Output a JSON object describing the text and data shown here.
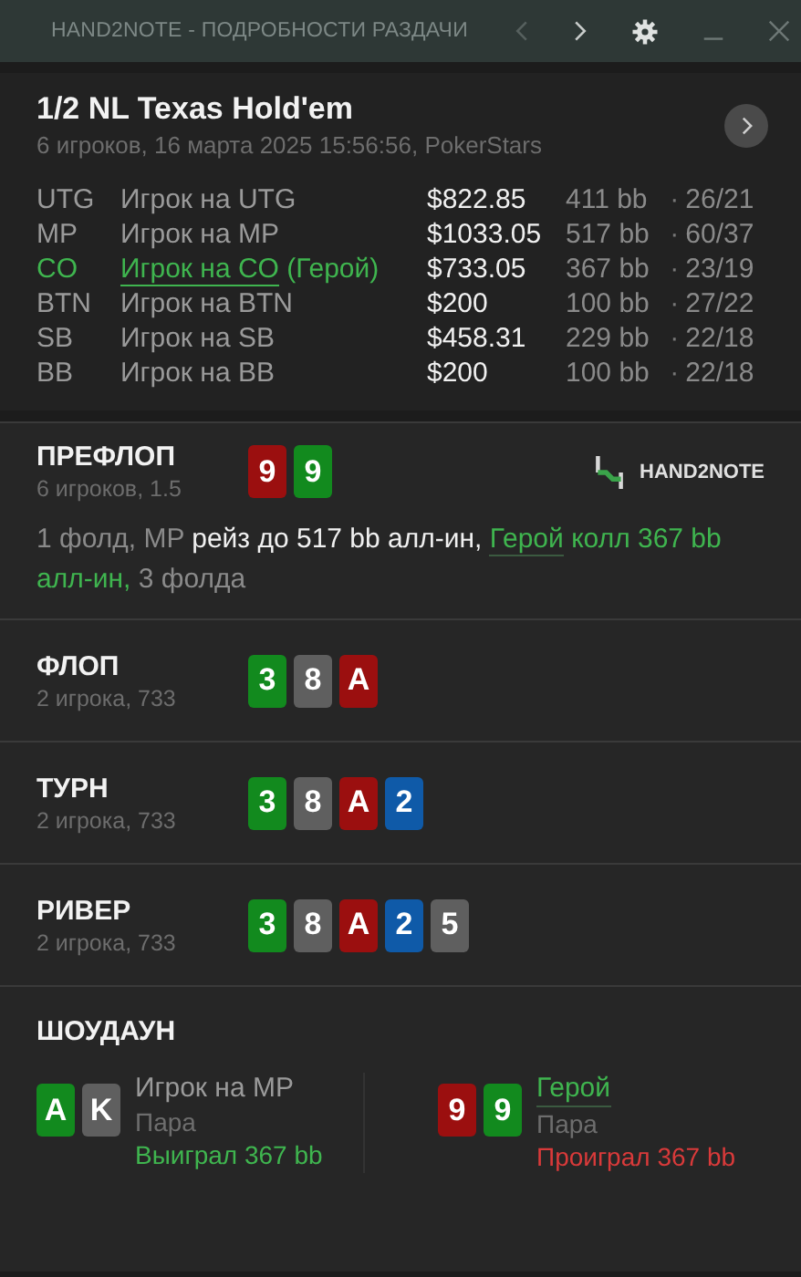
{
  "window": {
    "title": "HAND2NOTE - ПОДРОБНОСТИ РАЗДАЧИ"
  },
  "hand": {
    "title": "1/2 NL Texas Hold'em",
    "subtitle": "6 игроков, 16 марта 2025 15:56:56, PokerStars"
  },
  "players": [
    {
      "position": "UTG",
      "name": "Игрок на UTG",
      "stack": "$822.85",
      "bb": "411 bb",
      "separator": "·",
      "stats": "26/21",
      "hero": false
    },
    {
      "position": "MP",
      "name": "Игрок на MP",
      "stack": "$1033.05",
      "bb": "517 bb",
      "separator": "·",
      "stats": "60/37",
      "hero": false
    },
    {
      "position": "CO",
      "name": "Игрок на CO",
      "tag": "(Герой)",
      "stack": "$733.05",
      "bb": "367 bb",
      "separator": "·",
      "stats": "23/19",
      "hero": true
    },
    {
      "position": "BTN",
      "name": "Игрок на BTN",
      "stack": "$200",
      "bb": "100 bb",
      "separator": "·",
      "stats": "27/22",
      "hero": false
    },
    {
      "position": "SB",
      "name": "Игрок на SB",
      "stack": "$458.31",
      "bb": "229 bb",
      "separator": "·",
      "stats": "22/18",
      "hero": false
    },
    {
      "position": "BB",
      "name": "Игрок на BB",
      "stack": "$200",
      "bb": "100 bb",
      "separator": "·",
      "stats": "22/18",
      "hero": false
    }
  ],
  "preflop": {
    "title": "ПРЕФЛОП",
    "subtitle": "6 игроков, 1.5",
    "cards": [
      {
        "rank": "9",
        "color": "#9b0f0f"
      },
      {
        "rank": "9",
        "color": "#128a1e"
      }
    ],
    "logo": "HAND2NOTE",
    "action": [
      {
        "text": "1 фолд, MP ",
        "kind": "muted"
      },
      {
        "text": "рейз до 517 bb алл-ин, ",
        "kind": "bright"
      },
      {
        "text": "Герой",
        "kind": "link"
      },
      {
        "text": " колл 367 bb алл-ин,",
        "kind": "hero"
      },
      {
        "text": " 3 фолда",
        "kind": "muted"
      }
    ]
  },
  "streets": [
    {
      "title": "ФЛОП",
      "subtitle": "2 игрока, 733",
      "cards": [
        {
          "rank": "3",
          "color": "#128a1e"
        },
        {
          "rank": "8",
          "color": "#5f5f5f"
        },
        {
          "rank": "A",
          "color": "#9b0f0f"
        }
      ]
    },
    {
      "title": "ТУРН",
      "subtitle": "2 игрока, 733",
      "cards": [
        {
          "rank": "3",
          "color": "#128a1e"
        },
        {
          "rank": "8",
          "color": "#5f5f5f"
        },
        {
          "rank": "A",
          "color": "#9b0f0f"
        },
        {
          "rank": "2",
          "color": "#0f5aa8"
        }
      ]
    },
    {
      "title": "РИВЕР",
      "subtitle": "2 игрока, 733",
      "cards": [
        {
          "rank": "3",
          "color": "#128a1e"
        },
        {
          "rank": "8",
          "color": "#5f5f5f"
        },
        {
          "rank": "A",
          "color": "#9b0f0f"
        },
        {
          "rank": "2",
          "color": "#0f5aa8"
        },
        {
          "rank": "5",
          "color": "#5f5f5f"
        }
      ]
    }
  ],
  "showdown": {
    "title": "ШОУДАУН",
    "players": [
      {
        "name": "Игрок на MP",
        "hero": false,
        "hand": "Пара",
        "result": "Выиграл 367 bb",
        "won": true,
        "cards": [
          {
            "rank": "A",
            "color": "#128a1e"
          },
          {
            "rank": "K",
            "color": "#5f5f5f"
          }
        ]
      },
      {
        "name": "Герой",
        "hero": true,
        "hand": "Пара",
        "result": "Проиграл 367 bb",
        "won": false,
        "cards": [
          {
            "rank": "9",
            "color": "#9b0f0f"
          },
          {
            "rank": "9",
            "color": "#128a1e"
          }
        ]
      }
    ]
  }
}
